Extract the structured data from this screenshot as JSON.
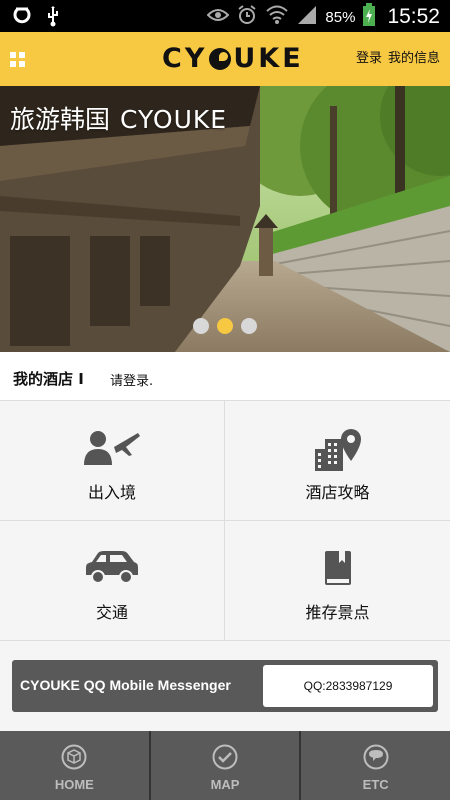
{
  "status_bar": {
    "battery_percent": "85%",
    "time": "15:52"
  },
  "header": {
    "logo_text": "CYOUKE",
    "login": "登录",
    "my_info": "我的信息"
  },
  "banner": {
    "title_cn": "旅游韩国",
    "title_en": "CYOUKE",
    "slides": 3,
    "active_slide": 2
  },
  "hotel": {
    "label": "我的酒店 I",
    "login_prompt": "请登录."
  },
  "menu": {
    "items": [
      {
        "label": "出入境",
        "icon": "immigration-icon"
      },
      {
        "label": "酒店攻略",
        "icon": "hotel-location-icon"
      },
      {
        "label": "交通",
        "icon": "car-icon"
      },
      {
        "label": "推存景点",
        "icon": "book-icon"
      }
    ]
  },
  "messenger": {
    "label": "CYOUKE QQ Mobile Messenger",
    "qq": "QQ:2833987129"
  },
  "bottom_nav": {
    "tabs": [
      {
        "label": "HOME",
        "icon": "home-cube-icon"
      },
      {
        "label": "MAP",
        "icon": "check-circle-icon"
      },
      {
        "label": "ETC",
        "icon": "chat-icon"
      }
    ]
  },
  "colors": {
    "brand_yellow": "#f7c842",
    "dark_gray": "#5a5a5a"
  }
}
